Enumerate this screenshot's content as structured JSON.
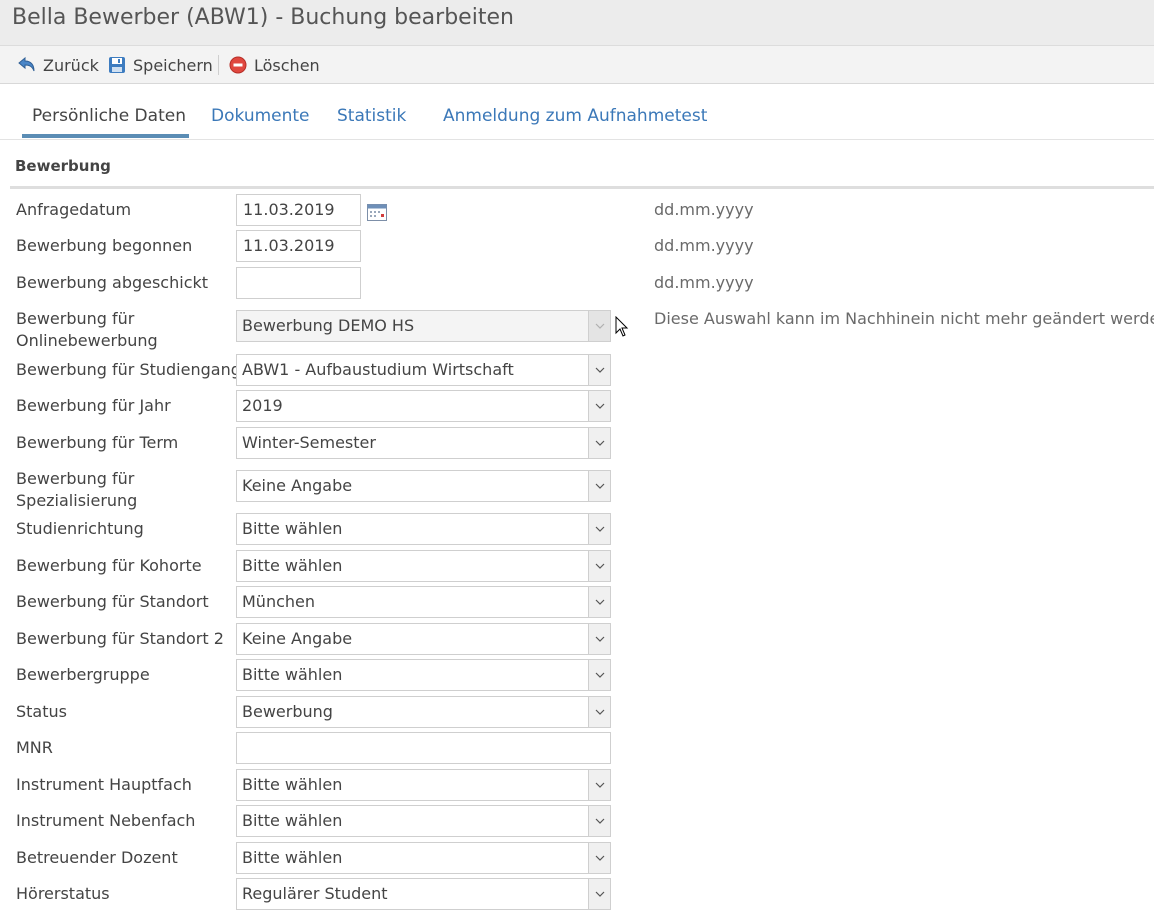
{
  "header": {
    "title": "Bella Bewerber (ABW1) - Buchung bearbeiten"
  },
  "toolbar": {
    "back": "Zurück",
    "save": "Speichern",
    "delete": "Löschen"
  },
  "tabs": [
    {
      "label": "Persönliche Daten"
    },
    {
      "label": "Dokumente"
    },
    {
      "label": "Statistik"
    },
    {
      "label": "Anmeldung zum Aufnahmetest"
    }
  ],
  "section": {
    "title": "Bewerbung"
  },
  "form": {
    "anfragedatum": {
      "label": "Anfragedatum",
      "value": "11.03.2019",
      "hint": "dd.mm.yyyy"
    },
    "begonnen": {
      "label": "Bewerbung begonnen",
      "value": "11.03.2019",
      "hint": "dd.mm.yyyy"
    },
    "abgeschickt": {
      "label": "Bewerbung abgeschickt",
      "value": "",
      "hint": "dd.mm.yyyy"
    },
    "online": {
      "label_1": "Bewerbung für",
      "label_2": "Onlinebewerbung",
      "value": "Bewerbung DEMO HS",
      "hint": "Diese Auswahl kann im Nachhinein nicht mehr geändert werden!"
    },
    "studiengang": {
      "label": "Bewerbung für Studiengang",
      "value": "ABW1 - Aufbaustudium Wirtschaft"
    },
    "jahr": {
      "label": "Bewerbung für Jahr",
      "value": "2019"
    },
    "term": {
      "label": "Bewerbung für Term",
      "value": "Winter-Semester"
    },
    "spezialisierung": {
      "label_1": "Bewerbung für",
      "label_2": "Spezialisierung",
      "value": "Keine Angabe"
    },
    "studienrichtung": {
      "label": "Studienrichtung",
      "value": "Bitte wählen"
    },
    "kohorte": {
      "label": "Bewerbung für Kohorte",
      "value": "Bitte wählen"
    },
    "standort": {
      "label": "Bewerbung für Standort",
      "value": "München"
    },
    "standort2": {
      "label": "Bewerbung für Standort 2",
      "value": "Keine Angabe"
    },
    "bewerbergruppe": {
      "label": "Bewerbergruppe",
      "value": "Bitte wählen"
    },
    "status": {
      "label": "Status",
      "value": "Bewerbung"
    },
    "mnr": {
      "label": "MNR",
      "value": ""
    },
    "hauptfach": {
      "label": "Instrument Hauptfach",
      "value": "Bitte wählen"
    },
    "nebenfach": {
      "label": "Instrument Nebenfach",
      "value": "Bitte wählen"
    },
    "dozent": {
      "label": "Betreuender Dozent",
      "value": "Bitte wählen"
    },
    "hoererstatus": {
      "label": "Hörerstatus",
      "value": "Regulärer Student"
    }
  }
}
